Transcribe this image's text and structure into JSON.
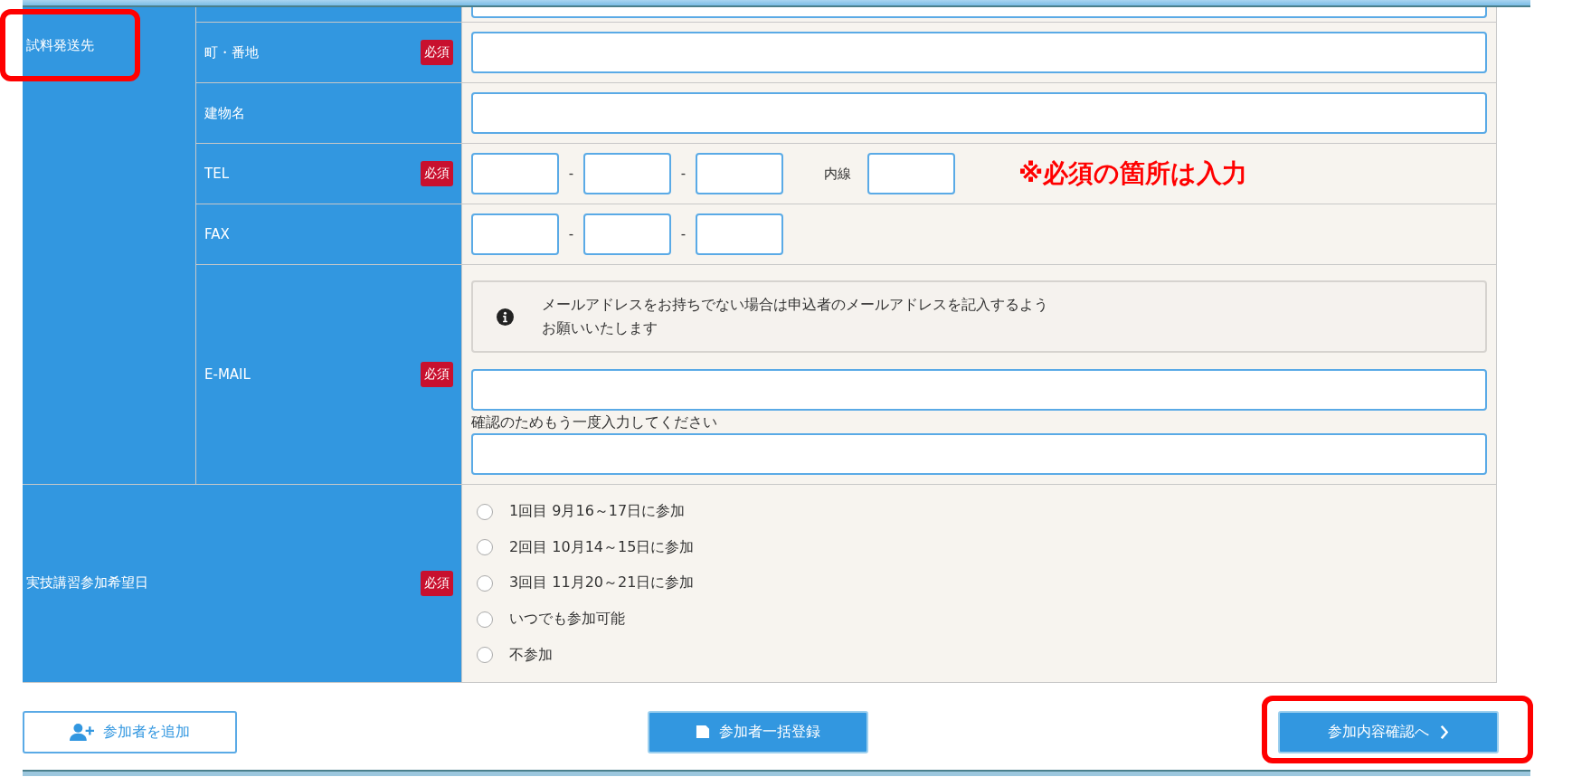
{
  "address_section": {
    "label": "試料発送先",
    "highlighted": true,
    "rows": [
      {
        "kind": "cut"
      },
      {
        "kind": "text",
        "label": "町・番地",
        "required": true,
        "badge": "必須"
      },
      {
        "kind": "text",
        "label": "建物名"
      },
      {
        "kind": "phone",
        "label": "TEL",
        "required": true,
        "badge": "必須",
        "separators": [
          "-",
          "-"
        ],
        "extension_label": "内線",
        "note": "※必須の箇所は入力"
      },
      {
        "kind": "phone",
        "label": "FAX",
        "separators": [
          "-",
          "-"
        ]
      },
      {
        "kind": "email",
        "label": "E-MAIL",
        "required": true,
        "badge": "必須",
        "notice_lines": [
          "メールアドレスをお持ちでない場合は申込者のメールアドレスを記入するよう",
          "お願いいたします"
        ],
        "confirm_label": "確認のためもう一度入力してください"
      }
    ]
  },
  "date_section": {
    "label": "実技講習参加希望日",
    "required": true,
    "badge": "必須",
    "options": [
      {
        "label": "1回目 9月16～17日に参加",
        "selected": false
      },
      {
        "label": "2回目 10月14～15日に参加",
        "selected": false
      },
      {
        "label": "3回目 11月20～21日に参加",
        "selected": false
      },
      {
        "label": "いつでも参加可能",
        "selected": false
      },
      {
        "label": "不参加",
        "selected": false
      }
    ]
  },
  "buttons": [
    {
      "kind": "add",
      "label": "参加者を追加",
      "highlighted": false
    },
    {
      "kind": "save",
      "label": "参加者一括登録",
      "highlighted": false
    },
    {
      "kind": "next",
      "label": "参加内容確認へ",
      "highlighted": true
    }
  ]
}
